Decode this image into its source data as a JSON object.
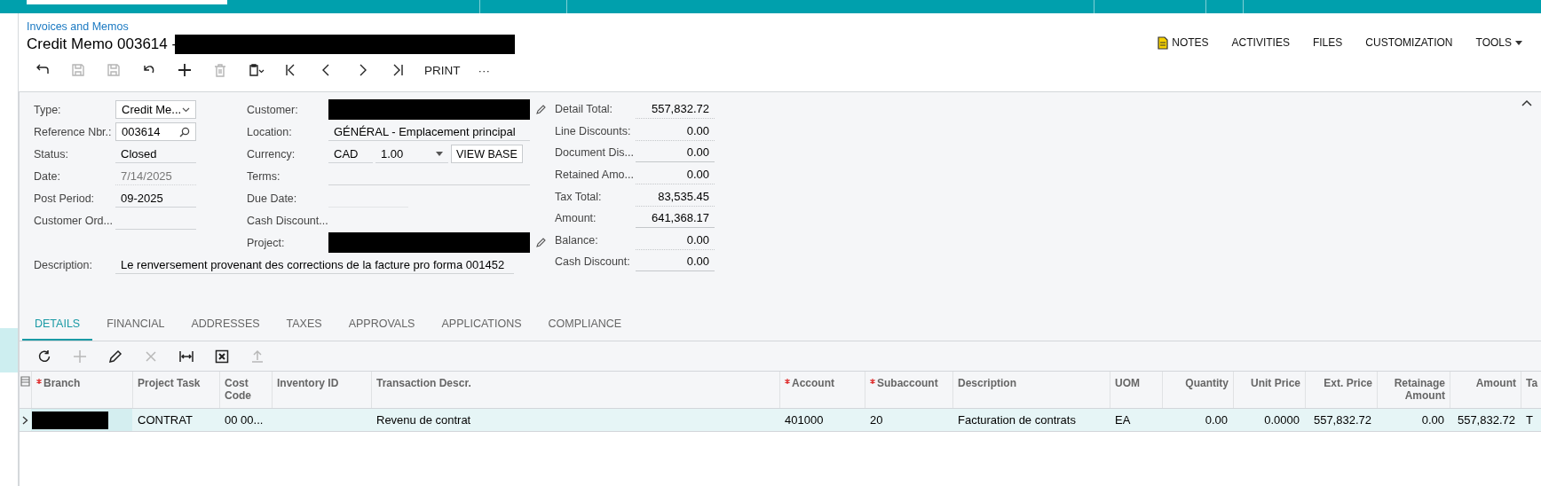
{
  "breadcrumb": "Invoices and Memos",
  "title": "Credit Memo 003614 -",
  "toolbar": [
    {
      "kind": "back",
      "disabled": false
    },
    {
      "kind": "save-close",
      "disabled": true
    },
    {
      "kind": "save",
      "disabled": true
    },
    {
      "kind": "undo",
      "disabled": false
    },
    {
      "kind": "add",
      "disabled": false
    },
    {
      "kind": "delete",
      "disabled": true
    },
    {
      "kind": "clipboard",
      "disabled": false
    },
    {
      "kind": "first",
      "disabled": false
    },
    {
      "kind": "prev",
      "disabled": false
    },
    {
      "kind": "next",
      "disabled": false
    },
    {
      "kind": "last",
      "disabled": false
    },
    {
      "kind": "text",
      "label": "PRINT",
      "disabled": false
    },
    {
      "kind": "text",
      "label": "···",
      "disabled": false
    }
  ],
  "top_actions": [
    {
      "label": "NOTES",
      "kind": "notes"
    },
    {
      "label": "ACTIVITIES",
      "kind": "plain"
    },
    {
      "label": "FILES",
      "kind": "plain"
    },
    {
      "label": "CUSTOMIZATION",
      "kind": "plain"
    },
    {
      "label": "TOOLS",
      "kind": "menu"
    }
  ],
  "summary_left": [
    {
      "label": "Type:",
      "kind": "select",
      "value": "Credit Me...",
      "disabled": false
    },
    {
      "label": "Reference Nbr.:",
      "kind": "search",
      "value": "003614",
      "disabled": false
    },
    {
      "label": "Status:",
      "kind": "text",
      "value": "Closed",
      "disabled": false
    },
    {
      "label": "Date:",
      "kind": "text",
      "value": "7/14/2025",
      "disabled": true
    },
    {
      "label": "Post Period:",
      "kind": "text",
      "value": "09-2025",
      "disabled": false
    },
    {
      "label": "Customer Ord...",
      "kind": "text",
      "disabled": false
    }
  ],
  "summary_middle": [
    {
      "label": "Customer:",
      "kind": "redacted"
    },
    {
      "label": "Location:",
      "kind": "text",
      "value": "GÉNÉRAL - Emplacement principal"
    },
    {
      "label": "Currency:",
      "kind": "currency",
      "value": "CAD",
      "rate": "1.00",
      "button": "VIEW BASE"
    },
    {
      "label": "Terms:",
      "kind": "text"
    },
    {
      "label": "Due Date:",
      "kind": "short"
    },
    {
      "label": "Cash Discount...",
      "kind": "none"
    },
    {
      "label": "Project:",
      "kind": "redacted"
    }
  ],
  "description": {
    "label": "Description:",
    "value": "Le renversement provenant des corrections de la facture pro forma 001452"
  },
  "totals": [
    {
      "label": "Detail Total:",
      "value": "557,832.72",
      "kind": "display"
    },
    {
      "label": "Line Discounts:",
      "value": "0.00",
      "kind": "display"
    },
    {
      "label": "Document Dis...",
      "value": "0.00",
      "kind": "input"
    },
    {
      "label": "Retained Amo...",
      "value": "0.00",
      "kind": "display"
    },
    {
      "label": "Tax Total:",
      "value": "83,535.45",
      "kind": "display"
    },
    {
      "label": "Amount:",
      "value": "641,368.17",
      "kind": "input"
    },
    {
      "label": "Balance:",
      "value": "0.00",
      "kind": "display"
    },
    {
      "label": "Cash Discount:",
      "value": "0.00",
      "kind": "input"
    }
  ],
  "tabs": [
    {
      "label": "DETAILS",
      "selected": true
    },
    {
      "label": "FINANCIAL",
      "selected": false
    },
    {
      "label": "ADDRESSES",
      "selected": false
    },
    {
      "label": "TAXES",
      "selected": false
    },
    {
      "label": "APPROVALS",
      "selected": false
    },
    {
      "label": "APPLICATIONS",
      "selected": false
    },
    {
      "label": "COMPLIANCE",
      "selected": false
    }
  ],
  "grid_toolbar": [
    {
      "kind": "refresh",
      "disabled": false
    },
    {
      "kind": "add",
      "disabled": true
    },
    {
      "kind": "edit",
      "disabled": false
    },
    {
      "kind": "delete",
      "disabled": true
    },
    {
      "kind": "fit",
      "disabled": false
    },
    {
      "kind": "excel",
      "disabled": false
    },
    {
      "kind": "upload",
      "disabled": true
    }
  ],
  "table": {
    "columns": [
      {
        "label": "Branch",
        "required": true
      },
      {
        "label": "Project Task",
        "required": false
      },
      {
        "label": "Cost Code",
        "required": false
      },
      {
        "label": "Inventory ID",
        "required": false
      },
      {
        "label": "Transaction Descr.",
        "required": false
      },
      {
        "label": "Account",
        "required": true
      },
      {
        "label": "Subaccount",
        "required": true
      },
      {
        "label": "Description",
        "required": false
      },
      {
        "label": "UOM",
        "required": false
      },
      {
        "label": "Quantity",
        "required": false
      },
      {
        "label": "Unit Price",
        "required": false
      },
      {
        "label": "Ext. Price",
        "required": false
      },
      {
        "label": "Retainage Amount",
        "required": false
      },
      {
        "label": "Amount",
        "required": false
      },
      {
        "label": "Ta",
        "required": false
      }
    ],
    "rows": [
      {
        "selected": true,
        "cells": [
          {
            "kind": "redacted"
          },
          {
            "kind": "text",
            "text": "CONTRAT"
          },
          {
            "kind": "text",
            "text": "00 00..."
          },
          {
            "kind": "empty"
          },
          {
            "kind": "text",
            "text": "Revenu de contrat"
          },
          {
            "kind": "text",
            "text": "401000"
          },
          {
            "kind": "text",
            "text": "20"
          },
          {
            "kind": "text",
            "text": "Facturation de contrats"
          },
          {
            "kind": "text",
            "text": "EA"
          },
          {
            "kind": "text",
            "text": "0.00"
          },
          {
            "kind": "text",
            "text": "0.0000"
          },
          {
            "kind": "text",
            "text": "557,832.72"
          },
          {
            "kind": "text",
            "text": "0.00"
          },
          {
            "kind": "text",
            "text": "557,832.72"
          },
          {
            "kind": "text",
            "text": "T"
          }
        ]
      }
    ]
  }
}
